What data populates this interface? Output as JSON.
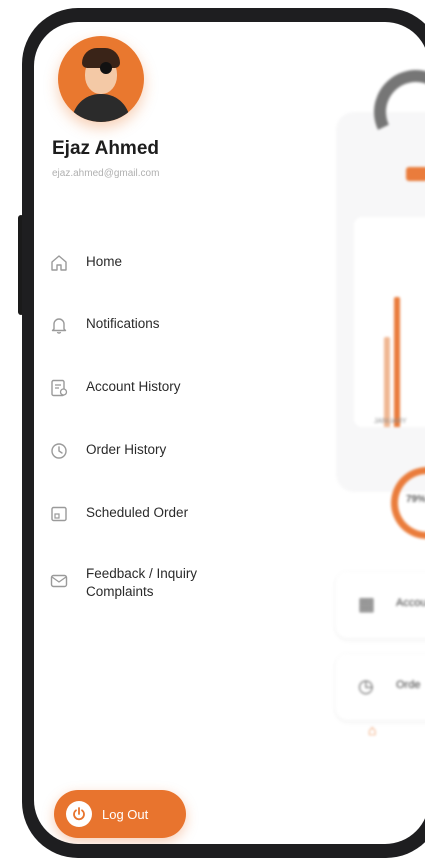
{
  "user": {
    "name": "Ejaz Ahmed",
    "email": "ejaz.ahmed@gmail.com"
  },
  "menu": {
    "items": [
      {
        "label": "Home",
        "icon": "home-icon"
      },
      {
        "label": "Notifications",
        "icon": "bell-icon"
      },
      {
        "label": "Account History",
        "icon": "account-history-icon"
      },
      {
        "label": "Order History",
        "icon": "clock-icon"
      },
      {
        "label": "Scheduled Order",
        "icon": "calendar-icon"
      },
      {
        "label": "Feedback / Inquiry Complaints",
        "icon": "mail-icon"
      }
    ]
  },
  "logout": {
    "label": "Log Out",
    "icon": "power-icon"
  },
  "background": {
    "chart_month": "JANUARY",
    "progress_label": "79%",
    "progress_value": 0.79,
    "item_account": "Accou",
    "item_orders": "Orde"
  },
  "colors": {
    "accent": "#e8742e",
    "text": "#2a2a2a",
    "muted": "#9a9a9a"
  }
}
